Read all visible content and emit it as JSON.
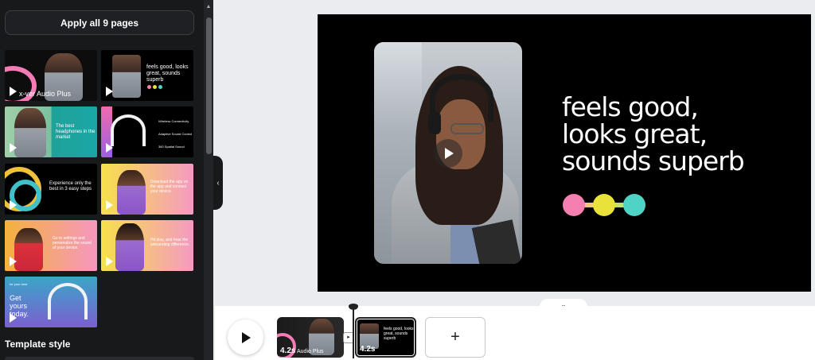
{
  "panel": {
    "apply_button": "Apply all 9 pages",
    "template_style_heading": "Template style",
    "templates": [
      {
        "text": "x-ver Audio Plus"
      },
      {
        "text": "feels good, looks great, sounds superb"
      },
      {
        "text": "The best headphones in the market"
      },
      {
        "lines": [
          "Wireless Connectivity",
          "Adaptive Sound Control",
          "360 Spatial Sound"
        ]
      },
      {
        "text": "Experience only the best in 3 easy steps"
      },
      {
        "text": "Download the app on the app and connect your device."
      },
      {
        "text": "Go to settings and personalize the sound of your device."
      },
      {
        "text": "Hit play, and hear the astounding difference."
      },
      {
        "small": "for your best",
        "text": "Get yours today."
      }
    ]
  },
  "canvas": {
    "headline_lines": [
      "feels good,",
      "looks great,",
      "sounds superb"
    ],
    "dot_colors": [
      "#f57fb0",
      "#e9e23a",
      "#4fd3c4"
    ]
  },
  "timeline": {
    "clips": [
      {
        "duration": "4.2s",
        "subtitle": "Audio Plus"
      },
      {
        "duration": "4.2s",
        "mini_text": "feels good, looks great, sounds superb"
      }
    ],
    "add_label": "+",
    "collapse_label": "‹",
    "expand_label": "⌄"
  }
}
